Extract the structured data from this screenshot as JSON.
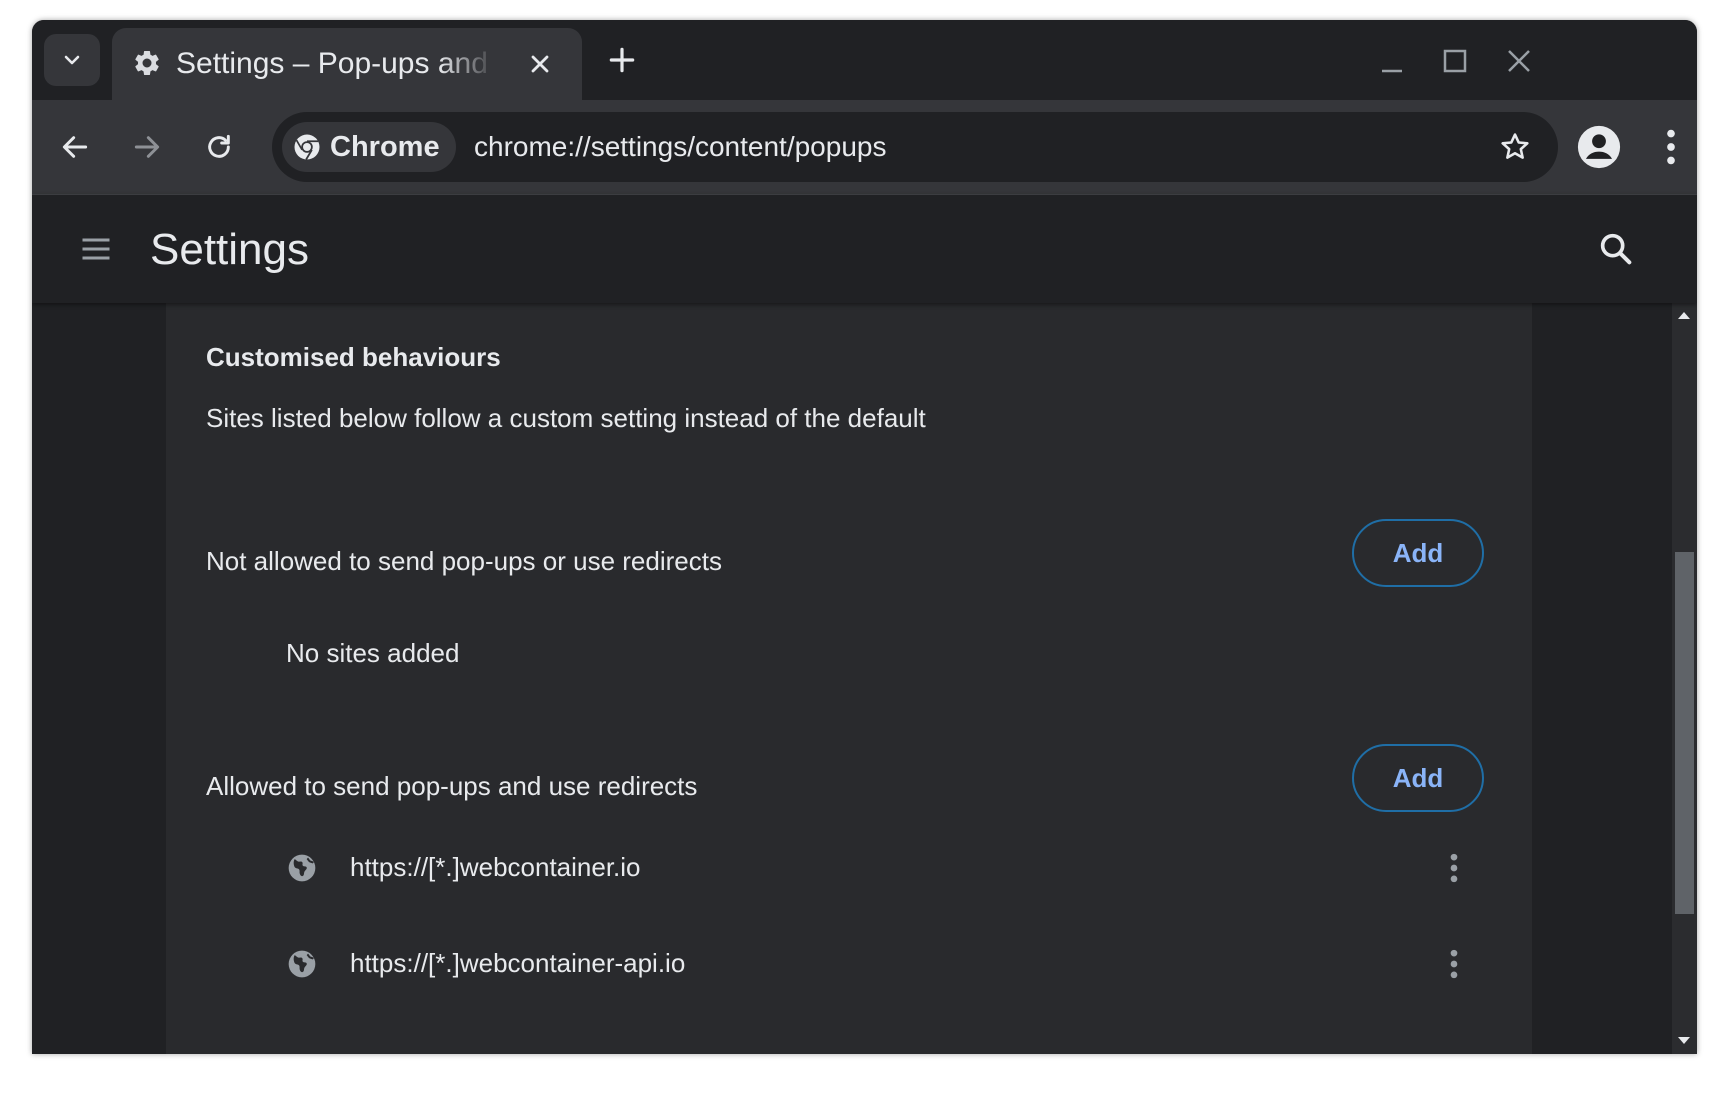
{
  "browser": {
    "tab": {
      "title": "Settings – Pop-ups and redirects",
      "favicon": "gear-icon"
    },
    "omnibox": {
      "chip_label": "Chrome",
      "url": "chrome://settings/content/popups"
    }
  },
  "settings": {
    "header_title": "Settings"
  },
  "section": {
    "title": "Customised behaviours",
    "description": "Sites listed below follow a custom setting instead of the default",
    "blocked": {
      "label": "Not allowed to send pop-ups or use redirects",
      "add_label": "Add",
      "empty_text": "No sites added"
    },
    "allowed": {
      "label": "Allowed to send pop-ups and use redirects",
      "add_label": "Add",
      "sites": [
        "https://[*.]webcontainer.io",
        "https://[*.]webcontainer-api.io"
      ]
    }
  },
  "colors": {
    "window_bg": "#202124",
    "toolbar_bg": "#35363a",
    "card_bg": "#292a2d",
    "text": "#e8eaed",
    "accent": "#8ab4f8",
    "button_border": "#1f6ea6"
  },
  "scrollbar": {
    "position_fraction": 0.66
  }
}
